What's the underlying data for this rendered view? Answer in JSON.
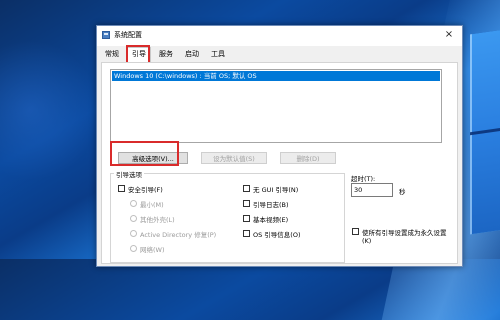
{
  "window": {
    "title": "系统配置",
    "close": "×"
  },
  "tabs": [
    "常规",
    "引导",
    "服务",
    "启动",
    "工具"
  ],
  "boot_list": {
    "items": [
      "Windows 10 (C:\\windows) : 当前 OS; 默认 OS"
    ]
  },
  "buttons": {
    "advanced": "高级选项(V)...",
    "set_default": "设为默认值(S)",
    "delete": "删除(D)"
  },
  "boot_options": {
    "group_label": "引导选项",
    "safe_boot": "安全引导(F)",
    "minimal": "最小(M)",
    "alternate_shell": "其他外壳(L)",
    "ad_repair": "Active Directory 修复(P)",
    "network": "网络(W)",
    "no_gui": "无 GUI 引导(N)",
    "boot_log": "引导日志(B)",
    "base_video": "基本视频(E)",
    "os_boot_info": "OS 引导信息(O)"
  },
  "timeout": {
    "label": "超时(T):",
    "value": "30",
    "unit": "秒"
  },
  "permanent": {
    "line1": "使所有引导设置成为永久设置",
    "line2": "(K)"
  },
  "colors": {
    "selection": "#0078d7",
    "highlight": "#d92b2b"
  }
}
